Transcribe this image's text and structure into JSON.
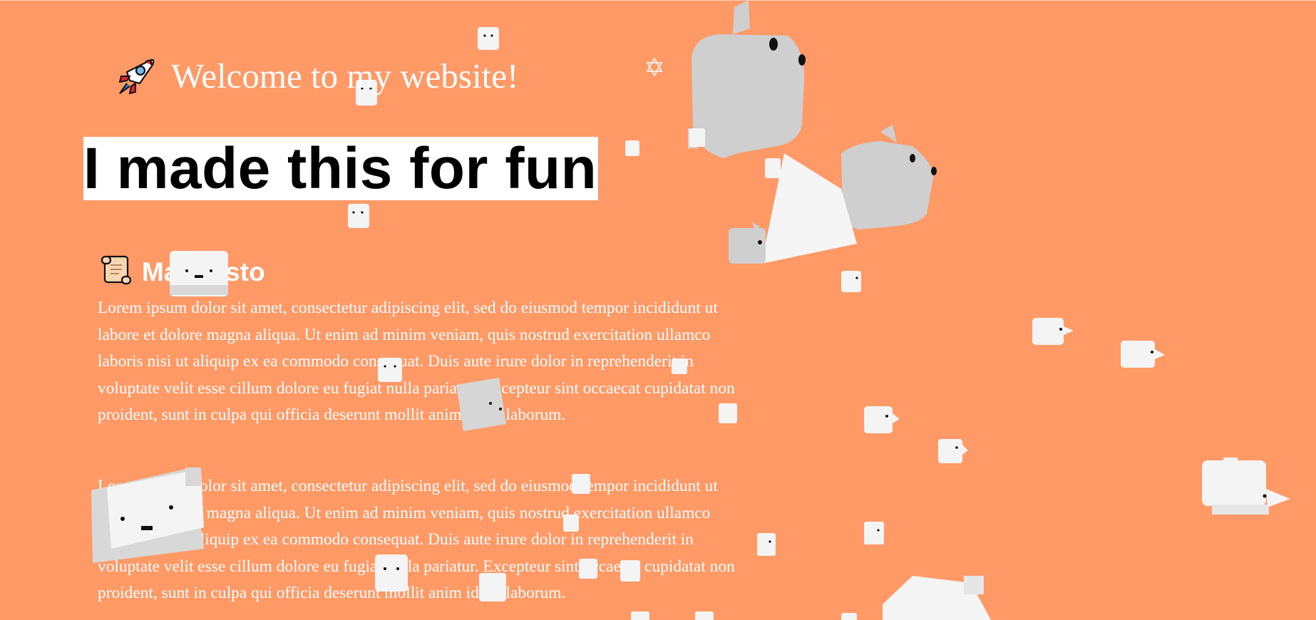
{
  "header": {
    "icon": "rocket-icon",
    "title": "Welcome to my website!"
  },
  "hero": {
    "headline": "I made this for fun"
  },
  "manifesto": {
    "icon": "scroll-icon",
    "heading": "Manifesto",
    "paragraphs": [
      "Lorem ipsum dolor sit amet, consectetur adipiscing elit, sed do eiusmod tempor incididunt ut labore et dolore magna aliqua. Ut enim ad minim veniam, quis nostrud exercitation ullamco laboris nisi ut aliquip ex ea commodo consequat. Duis aute irure dolor in reprehenderit in voluptate velit esse cillum dolore eu fugiat nulla pariatur. Excepteur sint occaecat cupidatat non proident, sunt in culpa qui officia deserunt mollit anim id est laborum.",
      "Lorem ipsum dolor sit amet, consectetur adipiscing elit, sed do eiusmod tempor incididunt ut labore et dolore magna aliqua. Ut enim ad minim veniam, quis nostrud exercitation ullamco laboris nisi ut aliquip ex ea commodo consequat. Duis aute irure dolor in reprehenderit in voluptate velit esse cillum dolore eu fugiat nulla pariatur. Excepteur sint occaecat cupidatat non proident, sunt in culpa qui officia deserunt mollit anim id est laborum."
    ]
  },
  "scene": {
    "object_icon": "cube-creature-icon",
    "decoration_icon": "hexagram-icon"
  },
  "colors": {
    "background": "#ff9966",
    "text": "#ffffff",
    "hero_background": "#ffffff",
    "hero_text": "#000000",
    "creature_light": "#f4f4f4",
    "creature_shadow": "#cfcfcf",
    "creature_eyes": "#111111"
  }
}
